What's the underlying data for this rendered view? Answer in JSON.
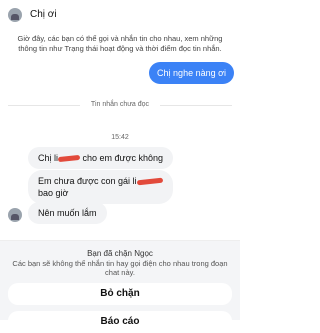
{
  "header": {
    "contact_name": "Chị ơi"
  },
  "notice": {
    "text": "Giờ đây, các bạn có thể gọi và nhắn tin cho nhau, xem những thông tin như Trạng thái hoạt động và thời điểm đọc tin nhắn."
  },
  "outgoing": {
    "text": "Chị nghe nàng ơi"
  },
  "unread_divider": {
    "label": "Tin nhắn chưa đọc"
  },
  "timestamp": "15:42",
  "messages": [
    {
      "prefix": "Chị li",
      "suffix": "cho em được không"
    },
    {
      "line1_prefix": "Em chưa được con gái li",
      "line2": "bao giờ"
    },
    {
      "text": "Nên muốn lắm"
    }
  ],
  "block_sheet": {
    "title": "Bạn đã chặn Ngọc",
    "subtitle": "Các bạn sẽ không thể nhắn tin hay gọi điện cho nhau trong đoạn chat này.",
    "unblock_label": "Bỏ chặn",
    "report_label": "Báo cáo"
  }
}
